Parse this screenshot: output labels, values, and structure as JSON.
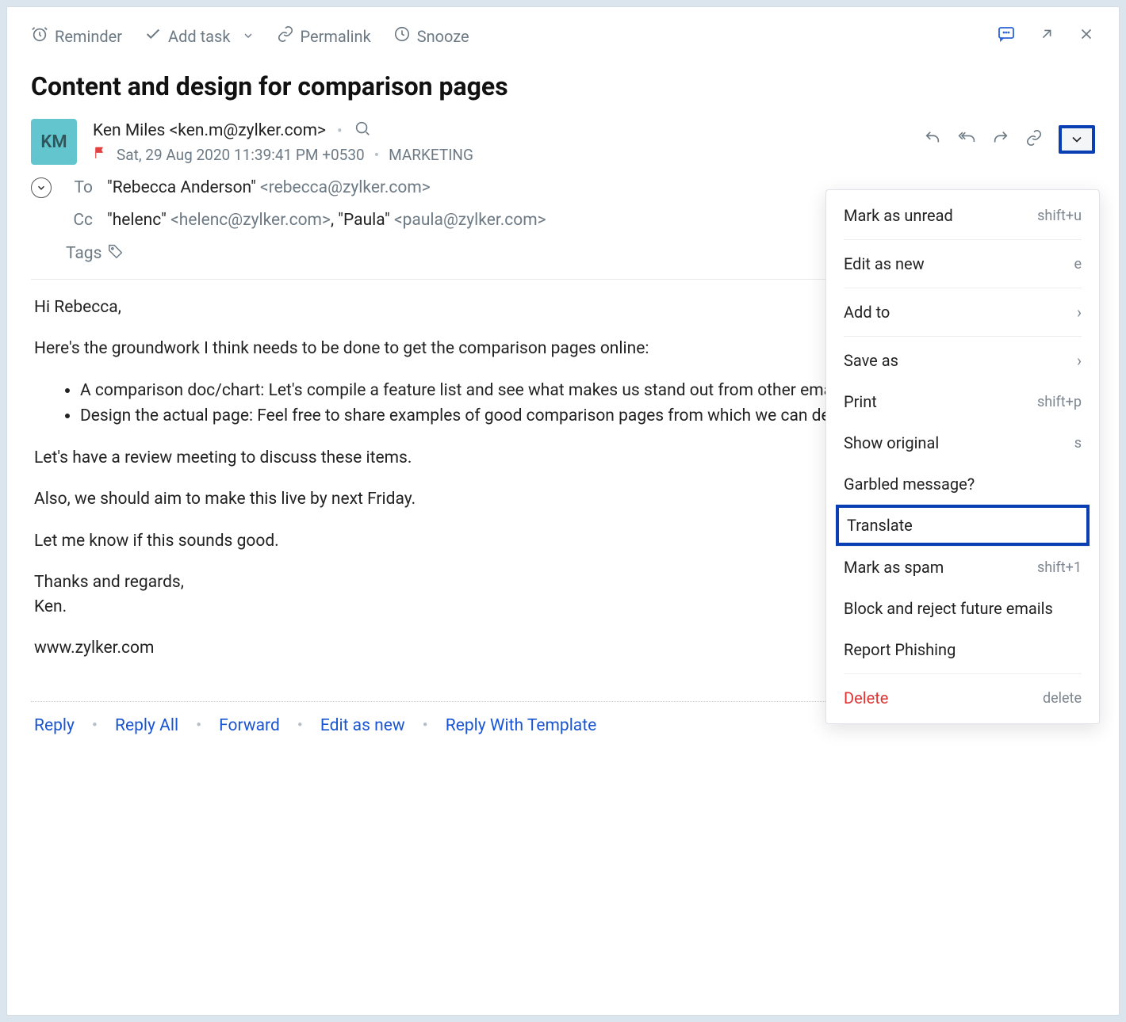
{
  "toolbar": {
    "reminder": "Reminder",
    "add_task": "Add task",
    "permalink": "Permalink",
    "snooze": "Snooze"
  },
  "subject": "Content and design for comparison pages",
  "avatar_initials": "KM",
  "sender": {
    "name": "Ken Miles",
    "email": "<ken.m@zylker.com>"
  },
  "meta": {
    "date": "Sat, 29 Aug 2020 11:39:41 PM +0530",
    "category": "MARKETING"
  },
  "recipients": {
    "to_label": "To",
    "to_name": "\"Rebecca Anderson\"",
    "to_email": "<rebecca@zylker.com>",
    "cc_label": "Cc",
    "cc_text1_name": "\"helenc\"",
    "cc_text1_email": "<helenc@zylker.com>",
    "cc_sep": ", ",
    "cc_text2_name": "\"Paula\"",
    "cc_text2_email": "<paula@zylker.com>",
    "tags_label": "Tags"
  },
  "body": {
    "greeting": "Hi Rebecca,",
    "intro": "Here's the groundwork I think needs to be done to get the comparison pages online:",
    "bullet1": "A comparison doc/chart: Let's compile a feature list and see what makes us stand out from other email providers.",
    "bullet2": "Design the actual page: Feel free to share examples of good comparison pages from which we can derive inspiration for our page.",
    "p1": "Let's have a review meeting to discuss these items.",
    "p2": "Also, we should aim to make this live by next Friday.",
    "p3": "Let me know if this sounds good.",
    "sig1": "Thanks and regards,",
    "sig2": "Ken.",
    "link": "www.zylker.com"
  },
  "footer": {
    "reply": "Reply",
    "reply_all": "Reply All",
    "forward": "Forward",
    "edit_as_new": "Edit as new",
    "reply_template": "Reply With Template"
  },
  "menu": {
    "mark_unread": "Mark as unread",
    "mark_unread_sc": "shift+u",
    "edit_as_new": "Edit as new",
    "edit_as_new_sc": "e",
    "add_to": "Add to",
    "save_as": "Save as",
    "print": "Print",
    "print_sc": "shift+p",
    "show_original": "Show original",
    "show_original_sc": "s",
    "garbled": "Garbled message?",
    "translate": "Translate",
    "mark_spam": "Mark as spam",
    "mark_spam_sc": "shift+1",
    "block": "Block and reject future emails",
    "phishing": "Report Phishing",
    "delete": "Delete",
    "delete_sc": "delete"
  }
}
